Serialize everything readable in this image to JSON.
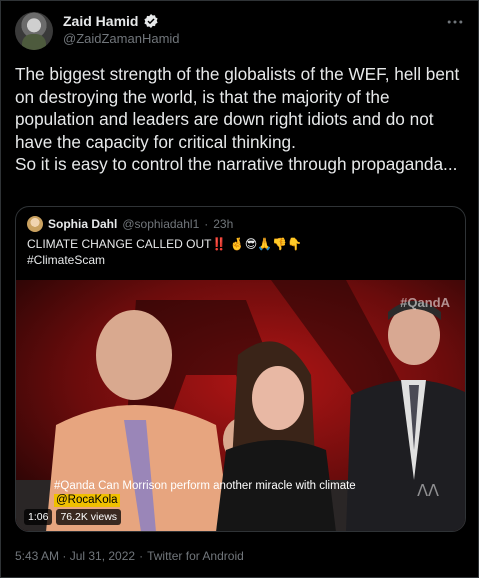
{
  "tweet": {
    "display_name": "Zaid Hamid",
    "handle": "@ZaidZamanHamid",
    "text": "The biggest strength of the globalists of the WEF, hell bent on destroying the world, is that the majority of the population and leaders are down right idiots and do not have the capacity for critical thinking.\nSo it is easy to control the narrative through propaganda...",
    "timestamp": "5:43 AM · Jul 31, 2022",
    "separator": "·",
    "source": "Twitter for Android"
  },
  "quoted": {
    "display_name": "Sophia Dahl",
    "handle": "@sophiadahl1",
    "separator": "·",
    "time": "23h",
    "line1": "CLIMATE CHANGE CALLED OUT‼️ 🤞😎🙏👎👇",
    "line2": "#ClimateScam",
    "video": {
      "watermark": "#QandA",
      "caption_line1": "#Qanda Can Morrison perform another miracle with climate",
      "caption_line2": "@RocaKola",
      "duration": "1:06",
      "views": "76.2K views",
      "abc_mark": "ᐱᐱ"
    }
  },
  "icons": {
    "verified": "verified-badge-icon",
    "more": "more-options-icon"
  },
  "colors": {
    "background": "#000000",
    "text": "#e7e9ea",
    "muted": "#71767b",
    "border": "#2f3336",
    "caption_highlight": "#f0c000"
  }
}
